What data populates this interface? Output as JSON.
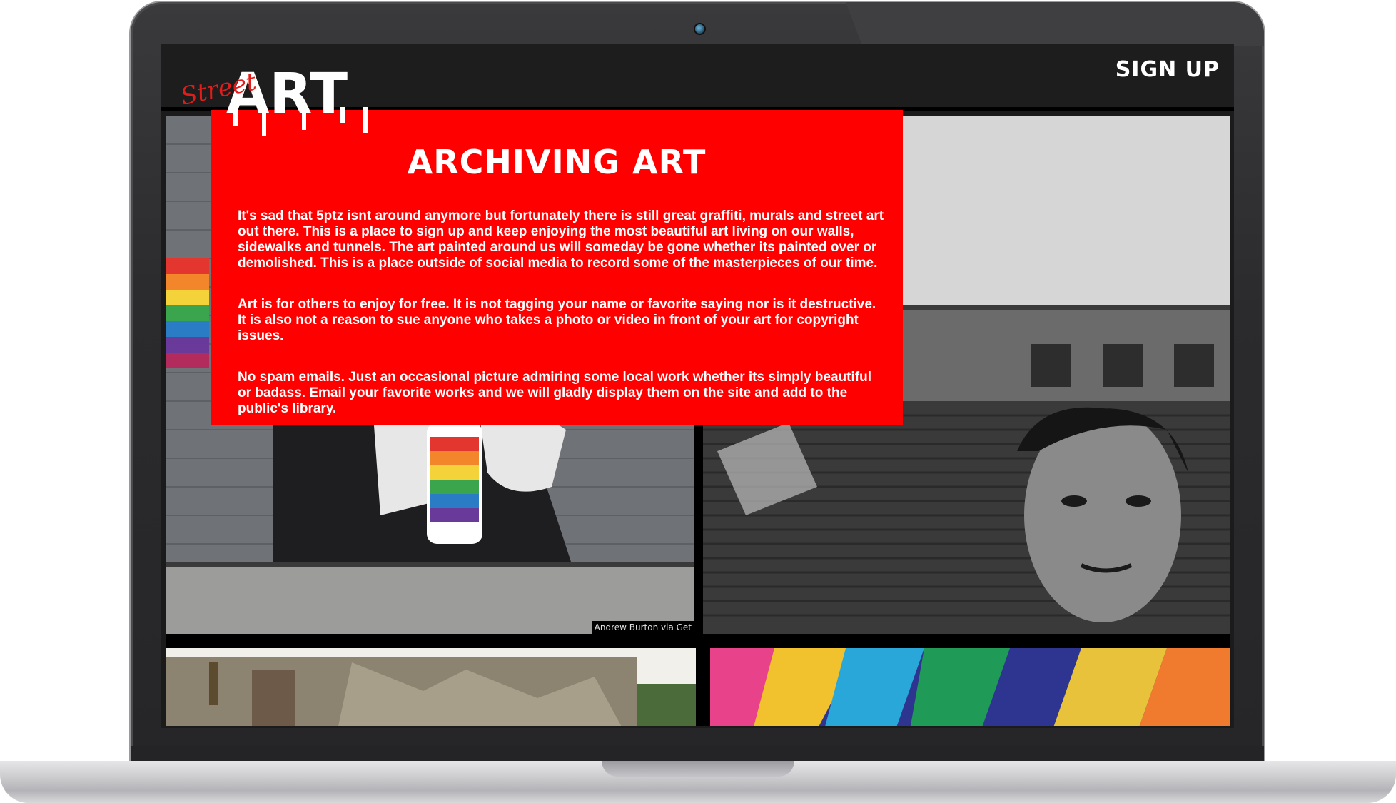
{
  "header": {
    "logo_script_text": "Street",
    "logo_main_text": "ART",
    "signup_label": "SIGN UP"
  },
  "panel": {
    "title": "ARCHIVING ART",
    "paragraphs": [
      "It's sad that 5ptz isnt around anymore but fortunately there is still great graffiti, murals and street art out there. This is a place to sign up and keep enjoying the most beautiful art living on our walls, sidewalks and tunnels. The art painted around us will someday be gone whether its painted over or demolished. This is a place outside of social media to record some of the masterpieces of our time.",
      "Art is for others to enjoy for free. It is not tagging your name or favorite saying nor is it destructive. It is also not a reason to sue anyone who takes a photo or video in front of your art for copyright issues.",
      "No spam emails. Just an occasional picture admiring some local work whether its simply beautiful or badass. Email your favorite works and we will gladly display them on the site and add to the public's library."
    ]
  },
  "gallery": {
    "photo1_caption": "Andrew Burton via Get"
  },
  "colors": {
    "accent": "#ff0000",
    "topbar": "#1d1d1d",
    "text": "#ffffff"
  }
}
